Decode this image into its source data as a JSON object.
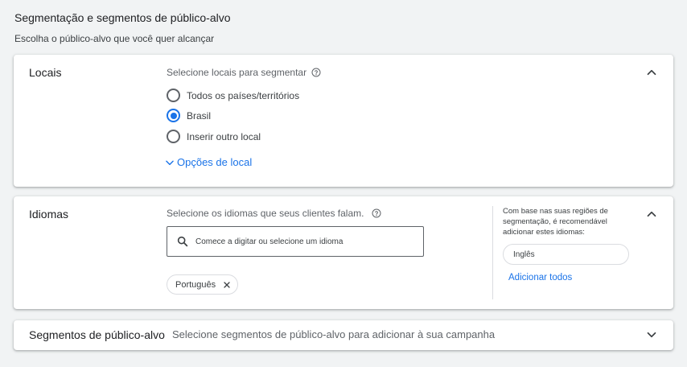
{
  "page": {
    "title": "Segmentação e segmentos de público-alvo",
    "subtitle": "Escolha o público-alvo que você quer alcançar"
  },
  "locations": {
    "title": "Locais",
    "prompt": "Selecione locais para segmentar",
    "options": [
      {
        "label": "Todos os países/territórios",
        "checked": false
      },
      {
        "label": "Brasil",
        "checked": true
      },
      {
        "label": "Inserir outro local",
        "checked": false
      }
    ],
    "more_options_label": "Opções de local"
  },
  "languages": {
    "title": "Idiomas",
    "prompt": "Selecione os idiomas que seus clientes falam.",
    "search_placeholder": "Comece a digitar ou selecione um idioma",
    "selected": [
      "Português"
    ],
    "recommendation_text": "Com base nas suas regiões de segmentação, é recomendável adicionar estes idiomas:",
    "recommended": [
      "Inglês"
    ],
    "add_all_label": "Adicionar todos"
  },
  "audience": {
    "title": "Segmentos de público-alvo",
    "placeholder": "Selecione segmentos de público-alvo para adicionar à sua campanha"
  },
  "colors": {
    "accent": "#1a73e8",
    "text": "#202124",
    "muted": "#5f6368",
    "background": "#f1f3f4"
  }
}
